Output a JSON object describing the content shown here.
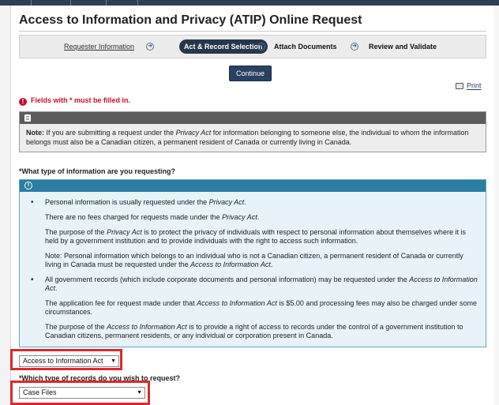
{
  "page": {
    "title": "Access to Information and Privacy (ATIP) Online Request"
  },
  "steps": [
    {
      "label": "Requester Information"
    },
    {
      "label": "Act & Record Selection"
    },
    {
      "label": "Attach Documents"
    },
    {
      "label": "Review and Validate"
    }
  ],
  "actions": {
    "continue_label": "Continue",
    "print_label": "Print"
  },
  "required_note": "Fields with * must be filled in.",
  "note": {
    "lead": "Note:",
    "text_1": " If you are submitting a request under the ",
    "act": "Privacy Act",
    "text_2": " for information belonging to someone else, the individual to whom the information belongs must also be a Canadian citizen, a permanent resident of Canada or currently living in Canada."
  },
  "question_type": "*What type of information are you requesting?",
  "info": {
    "b1_p1_a": "Personal information is usually requested under the ",
    "b1_p1_act": "Privacy Act",
    "b1_p1_b": ".",
    "b1_p2_a": "There are no fees charged for requests made under the ",
    "b1_p2_act": "Privacy Act",
    "b1_p2_b": ".",
    "b1_p3_a": "The purpose of the ",
    "b1_p3_act": "Privacy Act",
    "b1_p3_b": " is to protect the privacy of individuals with respect to personal information about themselves where it is held by a government institution and to provide individuals with the right to access such information.",
    "b1_p4_a": "Note: Personal information which belongs to an individual who is not a Canadian citizen, a permanent resident of Canada or currently living in Canada must be requested under the ",
    "b1_p4_act": "Access to Information Act",
    "b1_p4_b": ".",
    "b2_p1_a": "All government records (which include corporate documents and personal information) may be requested under the ",
    "b2_p1_act": "Access to Information Act",
    "b2_p1_b": ".",
    "b2_p2_a": "The application fee for request made under that ",
    "b2_p2_act": "Access to Information Act",
    "b2_p2_b": " is $5.00 and processing fees may also be charged under some circumstances.",
    "b2_p3_a": "The purpose of the ",
    "b2_p3_act": "Access to Information Act",
    "b2_p3_b": " is to provide a right of access to records under the control of a government institution to Canadian citizens, permanent residents, or any individual or corporation present in Canada."
  },
  "act_select": {
    "value": "Access to Information Act"
  },
  "question_records": "*Which type of records do you wish to request?",
  "records_select": {
    "value": "Case Files"
  },
  "colors": {
    "navy": "#26374a",
    "button": "#284162",
    "info_header": "#2b7ea1",
    "info_bg": "#e7f3f8",
    "alert_red": "#c8102e",
    "highlight_red": "#e0262b"
  },
  "icons": {
    "step_arrow": "arrow-right-circle-icon",
    "print": "printer-icon",
    "alert": "exclamation-circle-icon",
    "note": "document-icon",
    "info": "info-circle-icon",
    "caret": "caret-down-icon"
  }
}
